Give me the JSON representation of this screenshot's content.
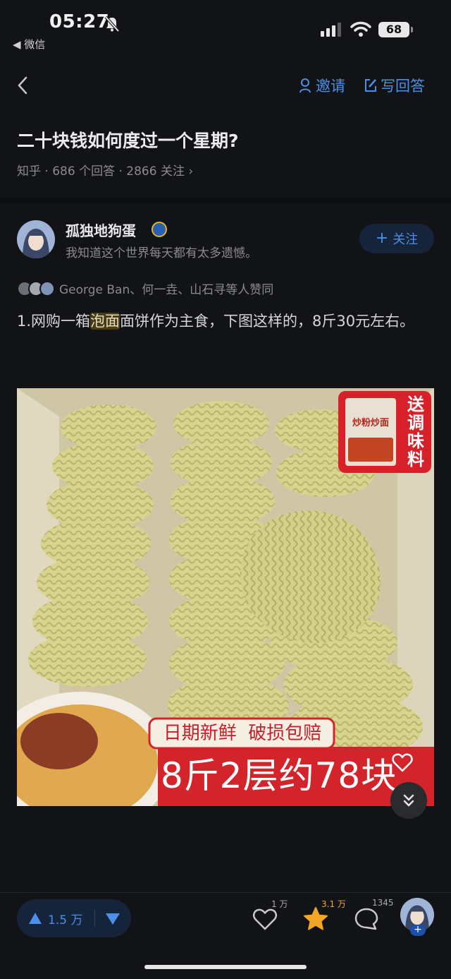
{
  "status_bar": {
    "time": "05:27",
    "back_app": "◀ 微信",
    "battery": "68"
  },
  "nav": {
    "invite": "邀请",
    "write_answer": "写回答"
  },
  "question": {
    "title": "二十块钱如何度过一个星期?",
    "meta": "知乎 · 686 个回答 · 2866 关注 ›"
  },
  "author": {
    "name": "孤独地狗蛋",
    "bio": "我知道这个世界每天都有太多遗憾。",
    "follow_label": "关注"
  },
  "upvoters_text": "George Ban、何一垚、山石寻等人赞同",
  "answer": {
    "prefix": "1.网购一箱",
    "highlight": "泡面",
    "suffix": "面饼作为主食，下图这样的，8斤30元左右。"
  },
  "image": {
    "promo_badge": "送调味料",
    "packet_label": "炒粉炒面",
    "banner_line1": "日期新鲜  破损包赔",
    "banner_line2": "8斤2层约78块"
  },
  "bottom_bar": {
    "upvote_count": "1.5 万",
    "like_count": "1 万",
    "favorite_count": "3.1 万",
    "comment_count": "1345",
    "plus": "+"
  },
  "colors": {
    "accent": "#4b8fe6",
    "favorite": "#f2a623",
    "background": "#121316"
  }
}
